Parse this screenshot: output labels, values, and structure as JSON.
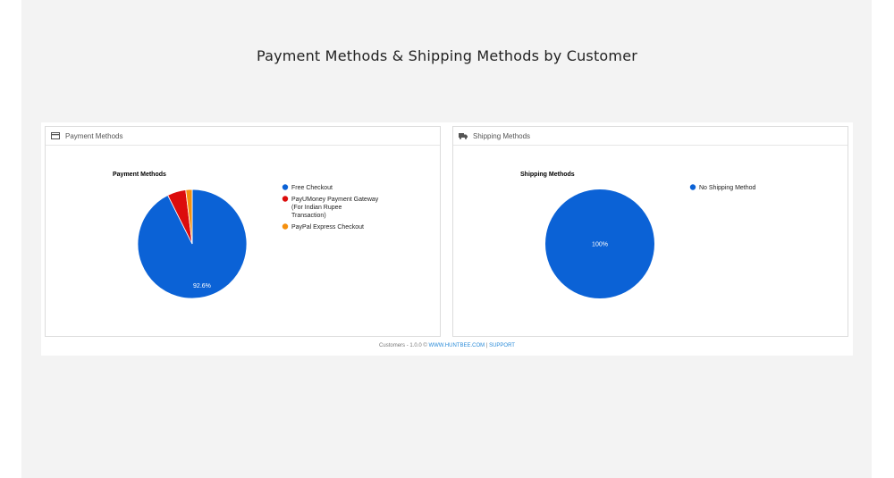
{
  "page": {
    "title": "Payment Methods & Shipping Methods by Customer"
  },
  "panels": {
    "payment": {
      "header": "Payment Methods",
      "icon": "credit-card-icon"
    },
    "shipping": {
      "header": "Shipping Methods",
      "icon": "truck-icon"
    }
  },
  "footer": {
    "text": "Customers - 1.0.0 ©",
    "link1": "WWW.HUNTBEE.COM",
    "sep": "|",
    "link2": "SUPPORT"
  },
  "chart_data": [
    {
      "type": "pie",
      "title": "Payment Methods",
      "legend_position": "right",
      "slices": [
        {
          "label": "Free Checkout",
          "value": 92.6,
          "color": "#0b62d6",
          "value_label": "92.6%"
        },
        {
          "label": "PayUMoney Payment Gateway (For Indian Rupee Transaction)",
          "value": 5.5,
          "color": "#dc0c0c",
          "value_label": ""
        },
        {
          "label": "PayPal Express Checkout",
          "value": 1.9,
          "color": "#f5900e",
          "value_label": ""
        }
      ]
    },
    {
      "type": "pie",
      "title": "Shipping Methods",
      "legend_position": "right",
      "slices": [
        {
          "label": "No Shipping Method",
          "value": 100,
          "color": "#0b62d6",
          "value_label": "100%"
        }
      ]
    }
  ]
}
